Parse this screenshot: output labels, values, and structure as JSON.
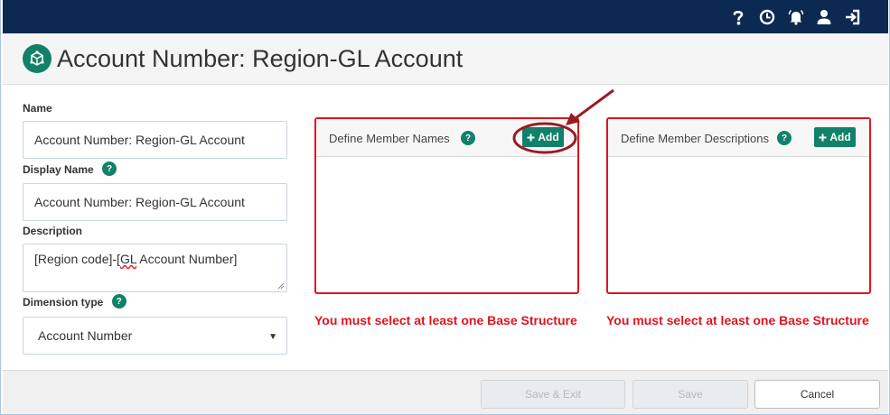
{
  "topbar": {
    "icons": [
      "help-icon",
      "history-icon",
      "notifications-icon",
      "user-icon",
      "sign-out-icon"
    ]
  },
  "header": {
    "title": "Account Number: Region-GL Account",
    "logo_icon": "dimension-cube-icon"
  },
  "form": {
    "name_label": "Name",
    "name_value": "Account Number: Region-GL Account",
    "display_name_label": "Display Name",
    "display_name_value": "Account Number: Region-GL Account",
    "description_label": "Description",
    "description_value_a": "[Region code]-[",
    "description_value_b": "GL",
    "description_value_c": " Account Number]",
    "dimension_type_label": "Dimension type",
    "dimension_type_value": "Account Number",
    "help_glyph": "?"
  },
  "panels": {
    "member_names": {
      "title": "Define Member Names",
      "add_label": "Add",
      "error": "You must select at least one Base Structure"
    },
    "member_descriptions": {
      "title": "Define Member Descriptions",
      "add_label": "Add",
      "error": "You must select at least one Base Structure"
    }
  },
  "footer": {
    "save_exit_label": "Save & Exit",
    "save_label": "Save",
    "cancel_label": "Cancel"
  },
  "colors": {
    "topbar": "#0c2952",
    "accent": "#128169",
    "error": "#e0141e",
    "annotation": "#9b1b22"
  }
}
